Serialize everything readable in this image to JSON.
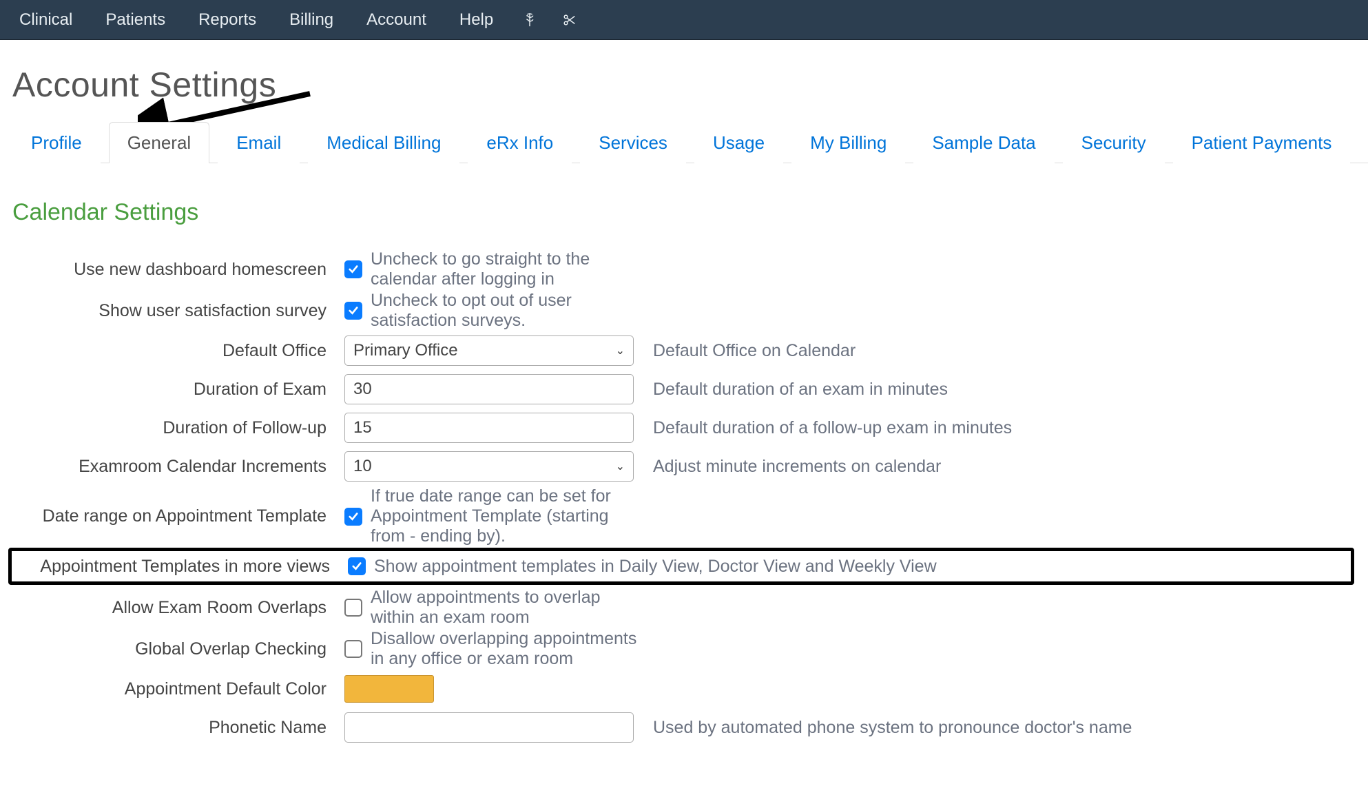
{
  "nav": {
    "items": [
      "Clinical",
      "Patients",
      "Reports",
      "Billing",
      "Account",
      "Help"
    ]
  },
  "page": {
    "title": "Account Settings"
  },
  "tabs": {
    "items": [
      "Profile",
      "General",
      "Email",
      "Medical Billing",
      "eRx Info",
      "Services",
      "Usage",
      "My Billing",
      "Sample Data",
      "Security",
      "Patient Payments"
    ],
    "active": "General"
  },
  "section": {
    "title": "Calendar Settings"
  },
  "settings": {
    "dashboard": {
      "label": "Use new dashboard homescreen",
      "checked": true,
      "help": "Uncheck to go straight to the calendar after logging in"
    },
    "survey": {
      "label": "Show user satisfaction survey",
      "checked": true,
      "help": "Uncheck to opt out of user satisfaction surveys."
    },
    "default_office": {
      "label": "Default Office",
      "value": "Primary Office",
      "help": "Default Office on Calendar"
    },
    "duration_exam": {
      "label": "Duration of Exam",
      "value": "30",
      "help": "Default duration of an exam in minutes"
    },
    "duration_followup": {
      "label": "Duration of Follow-up",
      "value": "15",
      "help": "Default duration of a follow-up exam in minutes"
    },
    "calendar_increments": {
      "label": "Examroom Calendar Increments",
      "value": "10",
      "help": "Adjust minute increments on calendar"
    },
    "date_range_template": {
      "label": "Date range on Appointment Template",
      "checked": true,
      "help": "If true date range can be set for Appointment Template (starting from - ending by)."
    },
    "templates_more_views": {
      "label": "Appointment Templates in more views",
      "checked": true,
      "help": "Show appointment templates in Daily View, Doctor View and Weekly View"
    },
    "allow_overlaps": {
      "label": "Allow Exam Room Overlaps",
      "checked": false,
      "help": "Allow appointments to overlap within an exam room"
    },
    "global_overlap": {
      "label": "Global Overlap Checking",
      "checked": false,
      "help": "Disallow overlapping appointments in any office or exam room"
    },
    "default_color": {
      "label": "Appointment Default Color",
      "value": "#f2b63c"
    },
    "phonetic_name": {
      "label": "Phonetic Name",
      "value": "",
      "help": "Used by automated phone system to pronounce doctor's name"
    }
  }
}
